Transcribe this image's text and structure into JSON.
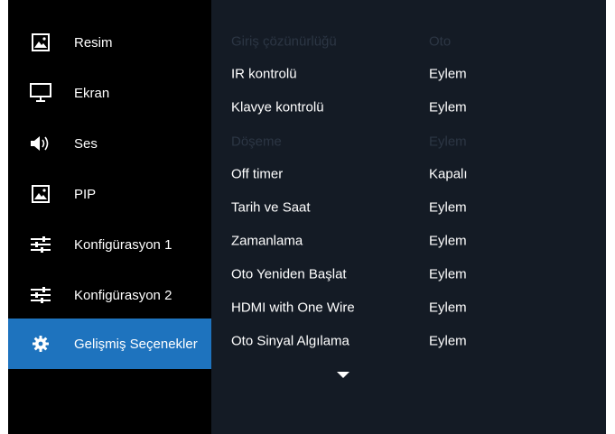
{
  "sidebar": {
    "items": [
      {
        "label": "Resim",
        "icon": "picture-icon",
        "selected": false
      },
      {
        "label": "Ekran",
        "icon": "monitor-icon",
        "selected": false
      },
      {
        "label": "Ses",
        "icon": "speaker-icon",
        "selected": false
      },
      {
        "label": "PIP",
        "icon": "picture-icon",
        "selected": false
      },
      {
        "label": "Konfigürasyon 1",
        "icon": "sliders-icon",
        "selected": false
      },
      {
        "label": "Konfigürasyon 2",
        "icon": "sliders-icon",
        "selected": false
      },
      {
        "label": "Gelişmiş Seçenekler",
        "icon": "gear-icon",
        "selected": true
      }
    ]
  },
  "settings": {
    "rows": [
      {
        "name": "Giriş çözünürlüğü",
        "value": "Oto",
        "enabled": false
      },
      {
        "name": "IR kontrolü",
        "value": "Eylem",
        "enabled": true
      },
      {
        "name": "Klavye kontrolü",
        "value": "Eylem",
        "enabled": true
      },
      {
        "name": "Döşeme",
        "value": "Eylem",
        "enabled": false
      },
      {
        "name": "Off timer",
        "value": "Kapalı",
        "enabled": true
      },
      {
        "name": "Tarih ve Saat",
        "value": "Eylem",
        "enabled": true
      },
      {
        "name": "Zamanlama",
        "value": "Eylem",
        "enabled": true
      },
      {
        "name": "Oto Yeniden Başlat",
        "value": "Eylem",
        "enabled": true
      },
      {
        "name": "HDMI with One Wire",
        "value": "Eylem",
        "enabled": true
      },
      {
        "name": "Oto Sinyal Algılama",
        "value": "Eylem",
        "enabled": true
      }
    ]
  },
  "scroll_indicator": {
    "icon": "triangle-down-icon"
  },
  "colors": {
    "background": "#000000",
    "panel": "#141b25",
    "selected": "#1e73be",
    "text": "#ffffff",
    "disabled_text": "#2c3644"
  }
}
